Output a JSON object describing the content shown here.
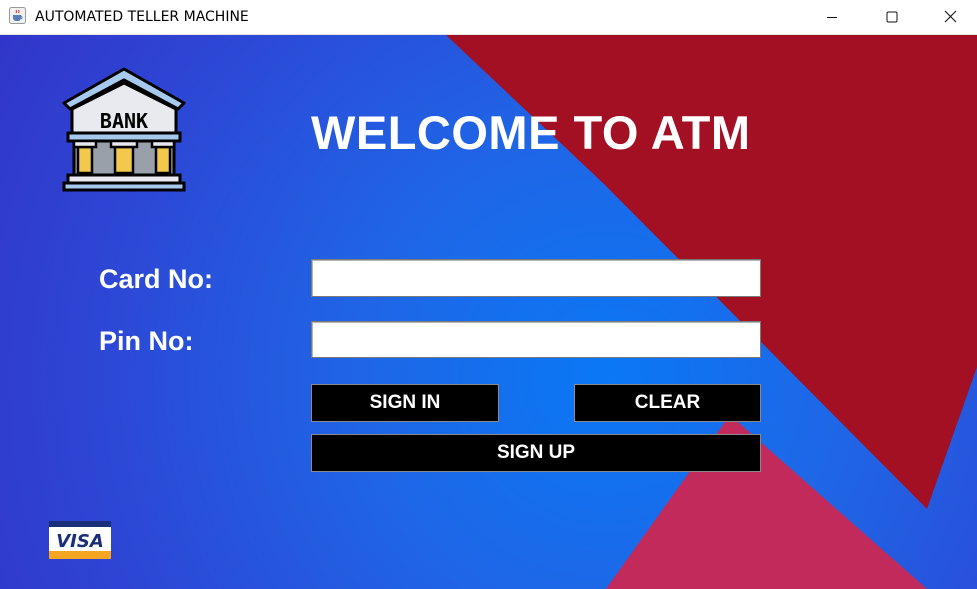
{
  "window": {
    "title": "AUTOMATED TELLER MACHINE",
    "app_icon": "java-cup-icon",
    "controls": [
      "minimize-icon",
      "maximize-icon",
      "close-icon"
    ]
  },
  "logo": {
    "text": "BANK",
    "icon": "bank-building-icon"
  },
  "heading": "WELCOME TO ATM",
  "form": {
    "card_label": "Card No:",
    "card_value": "",
    "pin_label": "Pin No:",
    "pin_value": ""
  },
  "buttons": {
    "sign_in": "SIGN IN",
    "clear": "CLEAR",
    "sign_up": "SIGN UP"
  },
  "card_brand": {
    "text": "VISA",
    "icon": "visa-card-icon"
  },
  "colors": {
    "background_blue": "#1f66e6",
    "background_red": "#a30f23",
    "background_pink": "#c22a5c",
    "button_bg": "#000000",
    "text": "#ffffff"
  }
}
